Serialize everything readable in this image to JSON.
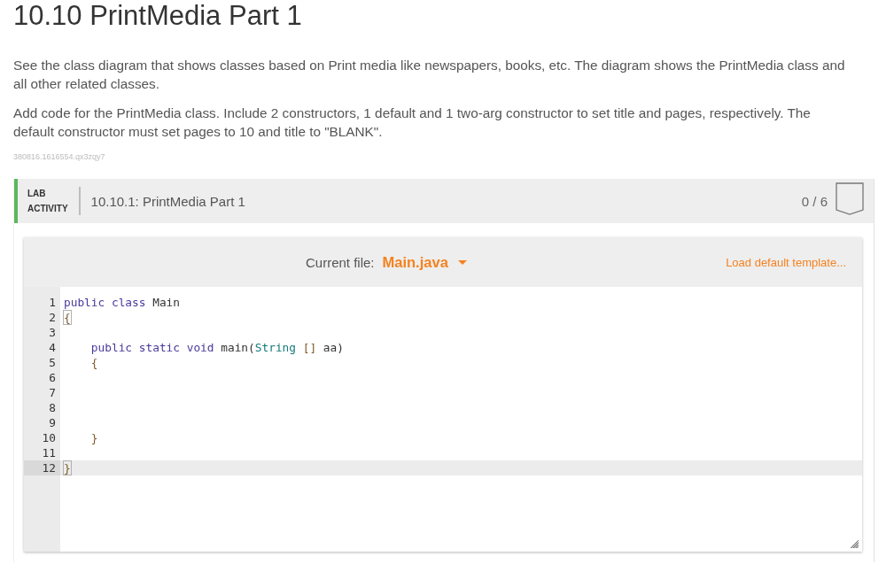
{
  "page": {
    "title": "10.10 PrintMedia Part 1",
    "paragraphs": [
      "See the class diagram that shows classes based on Print media like newspapers, books, etc. The diagram shows the PrintMedia class and all other related classes.",
      "Add code for the PrintMedia class. Include 2 constructors, 1 default and 1 two-arg constructor to set title and pages, respectively. The default constructor must set pages to 10 and title to \"BLANK\"."
    ],
    "content_id": "380816.1616554.qx3zqy7"
  },
  "lab_activity": {
    "label": "LAB ACTIVITY",
    "title": "10.10.1: PrintMedia Part 1",
    "score": "0 / 6",
    "editor": {
      "current_file_label": "Current file:",
      "current_file": "Main.java",
      "load_template": "Load default template...",
      "lines": [
        {
          "number": "1",
          "active": false,
          "tokens": [
            {
              "kind": "keyword",
              "text": "public ",
              "matched": false
            },
            {
              "kind": "keyword",
              "text": "class ",
              "matched": false
            },
            {
              "kind": "plain",
              "text": "Main",
              "matched": false
            }
          ]
        },
        {
          "number": "2",
          "active": false,
          "tokens": [
            {
              "kind": "bracket",
              "text": "{",
              "matched": true
            }
          ]
        },
        {
          "number": "3",
          "active": false
        },
        {
          "number": "4",
          "active": false,
          "tokens": [
            {
              "kind": "keyword",
              "text": "    public ",
              "matched": false
            },
            {
              "kind": "keyword",
              "text": "static ",
              "matched": false
            },
            {
              "kind": "keyword",
              "text": "void ",
              "matched": false
            },
            {
              "kind": "plain",
              "text": "main(",
              "matched": false
            },
            {
              "kind": "type",
              "text": "String",
              "matched": false
            },
            {
              "kind": "bracket",
              "text": " []",
              "matched": false
            },
            {
              "kind": "plain",
              "text": " aa)",
              "matched": false
            }
          ]
        },
        {
          "number": "5",
          "active": false,
          "tokens": [
            {
              "kind": "bracket",
              "text": "    {",
              "matched": false
            }
          ]
        },
        {
          "number": "6",
          "active": false
        },
        {
          "number": "7",
          "active": false
        },
        {
          "number": "8",
          "active": false
        },
        {
          "number": "9",
          "active": false
        },
        {
          "number": "10",
          "active": false,
          "tokens": [
            {
              "kind": "bracket",
              "text": "    }",
              "matched": false
            }
          ]
        },
        {
          "number": "11",
          "active": false
        },
        {
          "number": "12",
          "active": true,
          "tokens": [
            {
              "kind": "bracket",
              "text": "}",
              "matched": true
            }
          ]
        }
      ]
    }
  }
}
